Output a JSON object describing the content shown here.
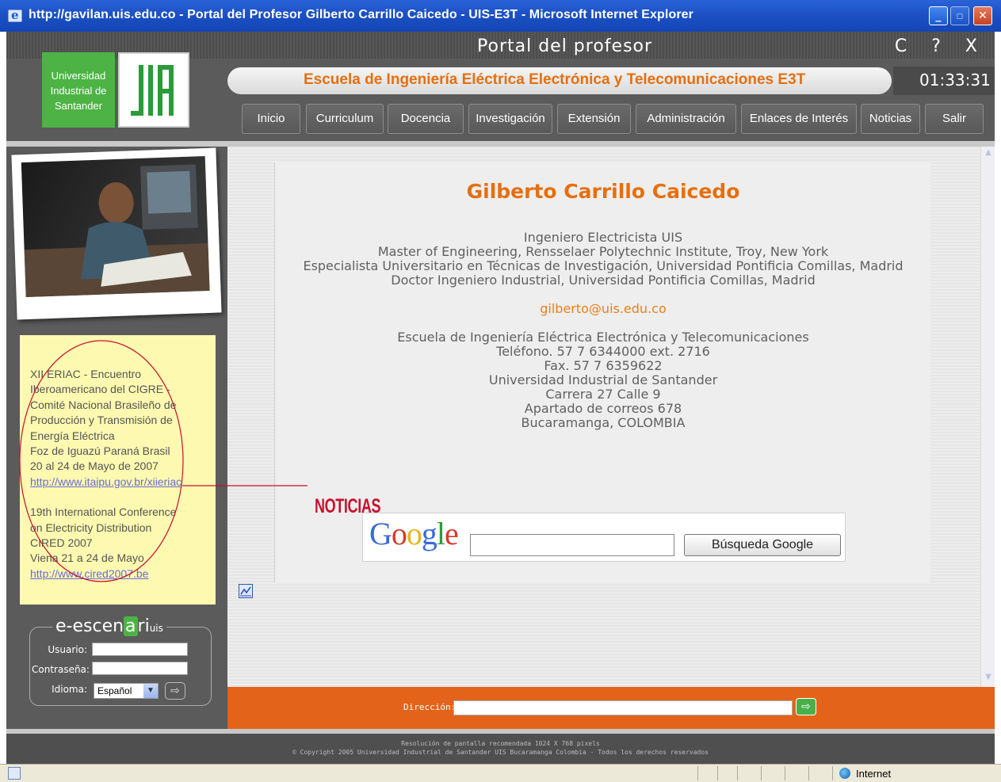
{
  "window": {
    "title": "http://gavilan.uis.edu.co - Portal del Profesor Gilberto Carrillo Caicedo - UIS-E3T - Microsoft Internet Explorer"
  },
  "header": {
    "portal_title": "Portal del profesor",
    "header_icons": "C ? X",
    "logo_text_line1": "Universidad",
    "logo_text_line2": "Industrial de",
    "logo_text_line3": "Santander",
    "school": "Escuela de Ingeniería Eléctrica Electrónica y Telecomunicaciones E3T",
    "clock": "01:33:31"
  },
  "nav": {
    "items": [
      {
        "label": "Inicio"
      },
      {
        "label": "Curriculum"
      },
      {
        "label": "Docencia"
      },
      {
        "label": "Investigación"
      },
      {
        "label": "Extensión"
      },
      {
        "label": "Administración"
      },
      {
        "label": "Enlaces de Interés"
      },
      {
        "label": "Noticias"
      },
      {
        "label": "Salir"
      }
    ]
  },
  "news": {
    "item1_lines": [
      "XII ERIAC - Encuentro",
      "Iberoamericano del CIGRE -",
      "Comité Nacional Brasileño de",
      "Producción y Transmisión de",
      "Energía Eléctrica",
      "Foz de Iguazú Paraná Brasil",
      "20 al 24 de Mayo de 2007"
    ],
    "item1_link": "http://www.itaipu.gov.br/xiieriac",
    "item2_lines": [
      "19th International Conference",
      "on Electricity Distribution",
      "CIRED 2007",
      "Viena 21 a 24 de Mayo"
    ],
    "item2_link": "http://www.cired2007.be",
    "annotation": "NOTICIAS"
  },
  "login": {
    "brand_a": "e-escen",
    "brand_b": "a",
    "brand_c": "ri",
    "brand_d": "uis",
    "user_label": "Usuario:",
    "pass_label": "Contraseña:",
    "lang_label": "Idioma:",
    "lang_value": "Español"
  },
  "profile": {
    "name": "Gilberto Carrillo Caicedo",
    "degrees": [
      "Ingeniero Electricista UIS",
      "Master of Engineering, Rensselaer Polytechnic Institute, Troy, New York",
      "Especialista Universitario en Técnicas de Investigación, Universidad Pontificia Comillas, Madrid",
      "Doctor Ingeniero Industrial, Universidad Pontificia Comillas, Madrid"
    ],
    "email": "gilberto@uis.edu.co",
    "contact": [
      "Escuela de Ingeniería Eléctrica Electrónica y Telecomunicaciones",
      "Teléfono.  57 7 6344000 ext. 2716",
      "Fax. 57 7 6359622",
      "Universidad Industrial de Santander",
      "Carrera 27 Calle 9",
      "Apartado de correos 678",
      "Bucaramanga, COLOMBIA"
    ]
  },
  "google": {
    "logo": "Google",
    "button": "Búsqueda Google",
    "colors": [
      "#3a6ad6",
      "#d83a2a",
      "#e8b31c",
      "#3a6ad6",
      "#2e9a3c",
      "#d83a2a"
    ]
  },
  "address": {
    "label": "Dirección:"
  },
  "footer": {
    "line1": "Resolución de pantalla recomendada 1024 X 768 pixels",
    "line2": "© Copyright 2005 Universidad Industrial de Santander UIS Bucaramanga Colombia - Todos los derechos reservados"
  },
  "statusbar": {
    "zone": "Internet"
  },
  "colors": {
    "accent_orange": "#e56f10",
    "brand_green": "#4db345",
    "annotation_red": "#c8102e"
  }
}
